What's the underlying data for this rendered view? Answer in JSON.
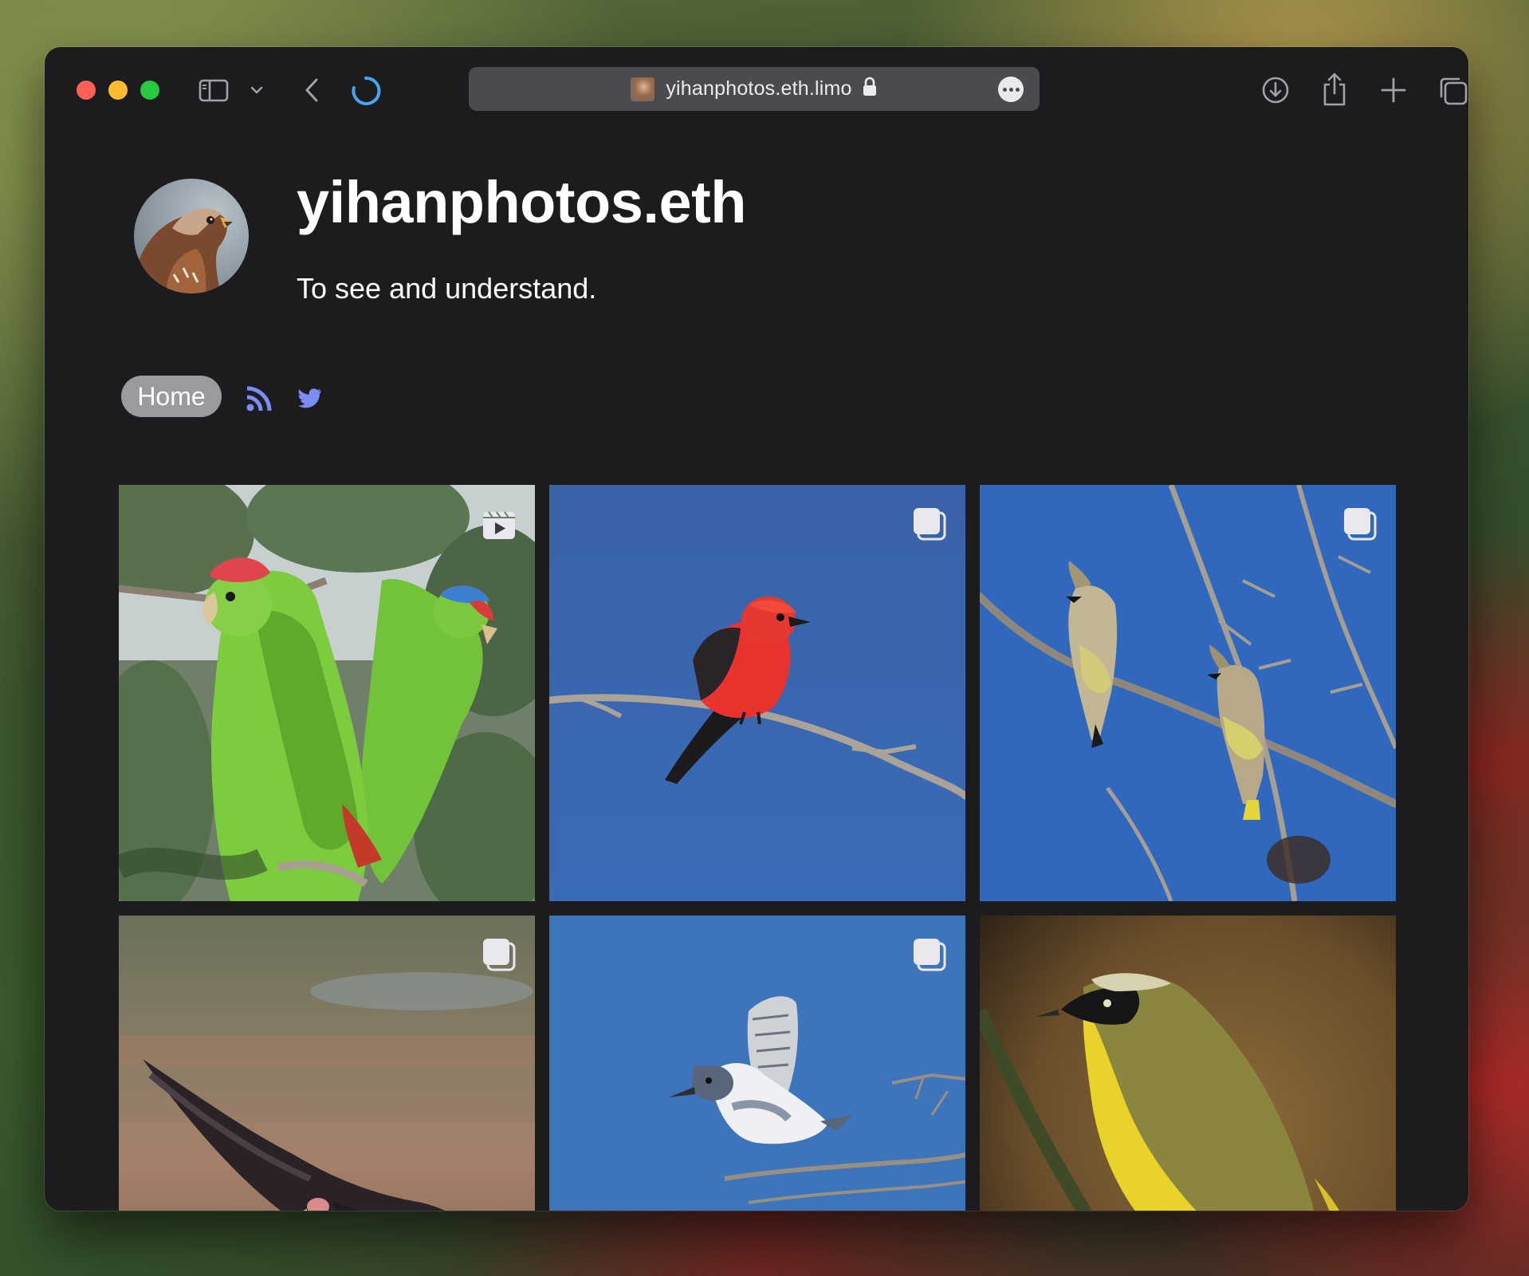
{
  "browser": {
    "url_text": "yihanphotos.eth.limo",
    "icons": {
      "sidebar": "sidebar-icon",
      "sidebar_menu": "chevron-down-icon",
      "back": "chevron-left-icon",
      "loading": "loading-spinner-icon",
      "lock": "lock-icon",
      "page_menu": "ellipsis-icon",
      "downloads": "download-icon",
      "share": "share-icon",
      "new_tab": "plus-icon",
      "tab_overview": "tabs-icon"
    },
    "accent_color": "#4aa3f0"
  },
  "profile": {
    "title": "yihanphotos.eth",
    "tagline": "To see and understand.",
    "avatar": "red-shouldered-hawk-portrait"
  },
  "nav": {
    "home_label": "Home",
    "rss_icon": "rss-icon",
    "twitter_icon": "twitter-icon",
    "link_color": "#7b8cf5"
  },
  "gallery": {
    "items": [
      {
        "subject": "red-crowned-parrots",
        "badge": "video-icon"
      },
      {
        "subject": "vermilion-flycatcher",
        "badge": "multiple-photos-icon"
      },
      {
        "subject": "cedar-waxwings",
        "badge": "multiple-photos-icon"
      },
      {
        "subject": "turkey-vulture-in-flight",
        "badge": "multiple-photos-icon"
      },
      {
        "subject": "belted-kingfisher",
        "badge": "multiple-photos-icon"
      },
      {
        "subject": "common-yellowthroat",
        "badge": "none"
      }
    ]
  }
}
